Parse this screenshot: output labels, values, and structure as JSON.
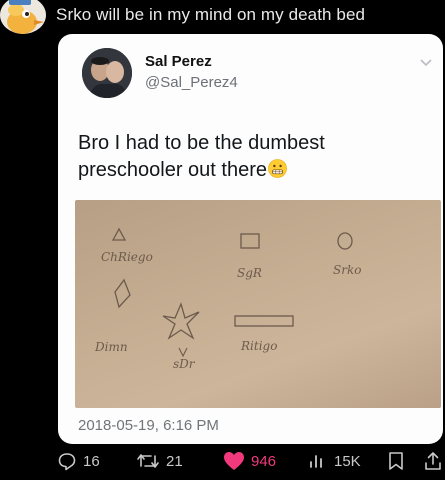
{
  "post": {
    "caption": "Srko will be in my mind on my death bed"
  },
  "tweet": {
    "author_name": "Sal Perez",
    "author_handle": "@Sal_Perez4",
    "text": "Bro I had to be the dumbest preschooler out there",
    "emoji": "grimacing-face",
    "timestamp": "2018-05-19, 6:16 PM",
    "photo": {
      "labels": [
        "ChRiego",
        "SgR",
        "Srko",
        "Dimn",
        "sDr",
        "Ritigo"
      ],
      "shapes": [
        "triangle",
        "square",
        "circle",
        "diamond",
        "star",
        "rectangle"
      ]
    }
  },
  "actions": {
    "replies": "16",
    "retweets": "21",
    "likes": "946",
    "views": "15K"
  },
  "colors": {
    "background": "#000000",
    "card": "#fdfdfd",
    "like": "#f2397c",
    "meta": "#707579"
  }
}
